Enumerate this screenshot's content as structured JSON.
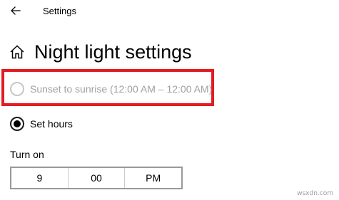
{
  "window": {
    "title": "Settings"
  },
  "page": {
    "title": "Night light settings"
  },
  "schedule": {
    "options": [
      {
        "label": "Sunset to sunrise (12:00 AM – 12:00 AM)",
        "selected": false,
        "disabled": true,
        "highlighted": true
      },
      {
        "label": "Set hours",
        "selected": true,
        "disabled": false
      }
    ]
  },
  "turn_on": {
    "label": "Turn on",
    "hour": "9",
    "minute": "00",
    "period": "PM"
  },
  "annotation": {
    "highlight_color": "#e31c23"
  },
  "icons": {
    "back": "back-arrow-icon",
    "home": "home-icon"
  },
  "watermark": "wsxdn.com"
}
